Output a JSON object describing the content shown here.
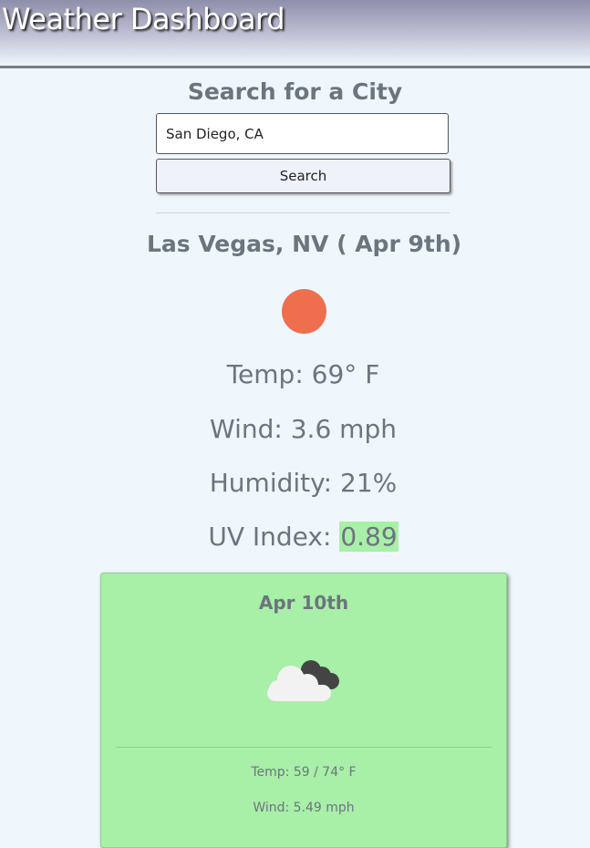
{
  "header": {
    "title": "Weather Dashboard"
  },
  "search": {
    "title": "Search for a City",
    "input_value": "San Diego, CA",
    "button_label": "Search"
  },
  "current": {
    "city_title": "Las Vegas, NV ( Apr 9th)",
    "icon": "sun-icon",
    "temp": "Temp: 69° F",
    "wind": "Wind: 3.6 mph",
    "humidity": "Humidity: 21%",
    "uv_label": "UV Index: ",
    "uv_value": "0.89"
  },
  "forecast": [
    {
      "date": "Apr 10th",
      "icon": "broken-clouds-icon",
      "temp": "Temp: 59 / 74° F",
      "wind": "Wind: 5.49 mph"
    }
  ],
  "colors": {
    "background": "#eff7fd",
    "text": "#6c757d",
    "sun": "#ee6e4e",
    "uv_low": "#a8efa8",
    "card": "#a8efa8"
  }
}
